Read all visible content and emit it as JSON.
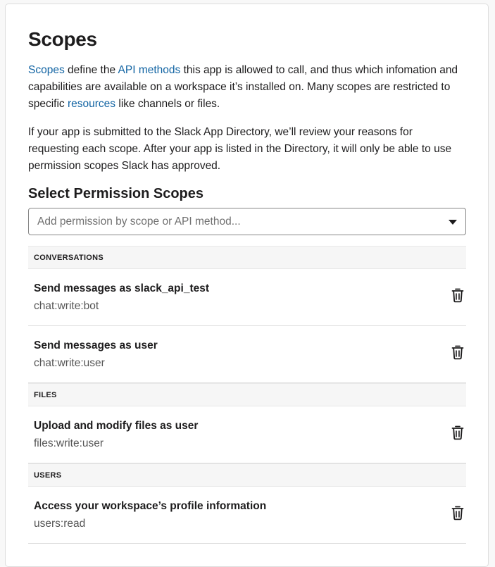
{
  "page": {
    "title": "Scopes",
    "intro": {
      "link_scopes": "Scopes",
      "text_1": " define the ",
      "link_api_methods": "API methods",
      "text_2": " this app is allowed to call, and thus which infomation and capabilities are available on a workspace it’s installed on. Many scopes are restricted to specific ",
      "link_resources": "resources",
      "text_3": " like channels or files."
    },
    "review_note": "If your app is submitted to the Slack App Directory, we’ll review your reasons for requesting each scope. After your app is listed in the Directory, it will only be able to use permission scopes Slack has approved."
  },
  "permissions": {
    "heading": "Select Permission Scopes",
    "search_placeholder": "Add permission by scope or API method...",
    "groups": [
      {
        "label": "CONVERSATIONS",
        "scopes": [
          {
            "title": "Send messages as slack_api_test",
            "code": "chat:write:bot"
          },
          {
            "title": "Send messages as user",
            "code": "chat:write:user"
          }
        ]
      },
      {
        "label": "FILES",
        "scopes": [
          {
            "title": "Upload and modify files as user",
            "code": "files:write:user"
          }
        ]
      },
      {
        "label": "USERS",
        "scopes": [
          {
            "title": "Access your workspace’s profile information",
            "code": "users:read"
          }
        ]
      }
    ]
  },
  "colors": {
    "link": "#1264a3",
    "text": "#1d1c1d",
    "muted": "#555555"
  },
  "icons": {
    "remove": "trash-icon",
    "dropdown": "caret-down-icon"
  }
}
